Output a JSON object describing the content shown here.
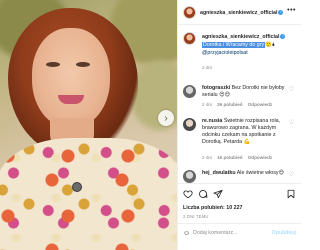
{
  "post": {
    "author": "agnieszka_sienkiewicz_official",
    "caption_part1": "Dorotka i Wracamy do gry",
    "caption_emoji": "🙂🌢",
    "caption_mention": "@przyjacioleipolsat",
    "caption_time": "2 dni"
  },
  "comments": [
    {
      "user": "fotograszki",
      "text": "Bez Dorotki nie byłoby serialu ",
      "emoji": "😍😍",
      "time": "2 dni",
      "likes": "26 polubień",
      "reply": "Odpowiedz"
    },
    {
      "user": "re.nusia",
      "text": "Świetnie rozpisana rola, brawurowo zagrana. W każdym odcinku czekam na spotkanie z Dorotką. Petarda ",
      "emoji": "💪",
      "time": "2 dni",
      "likes": "16 polubień",
      "reply": "Odpowiedz"
    },
    {
      "user": "hej_dwulatku",
      "text": "Ale świetne włosy",
      "emoji": "😍"
    }
  ],
  "actions": {
    "likes_label": "Liczba polubień:",
    "likes_count": "10 227",
    "date": "2 DNI TEMU",
    "comment_placeholder": "Dodaj komentarz...",
    "publish_label": "Opublikuj"
  },
  "icons": {
    "more": "more-icon",
    "heart": "heart-icon",
    "comment": "comment-icon",
    "share": "share-icon",
    "bookmark": "bookmark-icon",
    "smiley": "smiley-icon",
    "next": "chevron-right-icon"
  },
  "colors": {
    "highlight": "#4a8fe0",
    "link": "#00376b",
    "publish_disabled": "#b2dffc",
    "verified": "#3897f0"
  }
}
